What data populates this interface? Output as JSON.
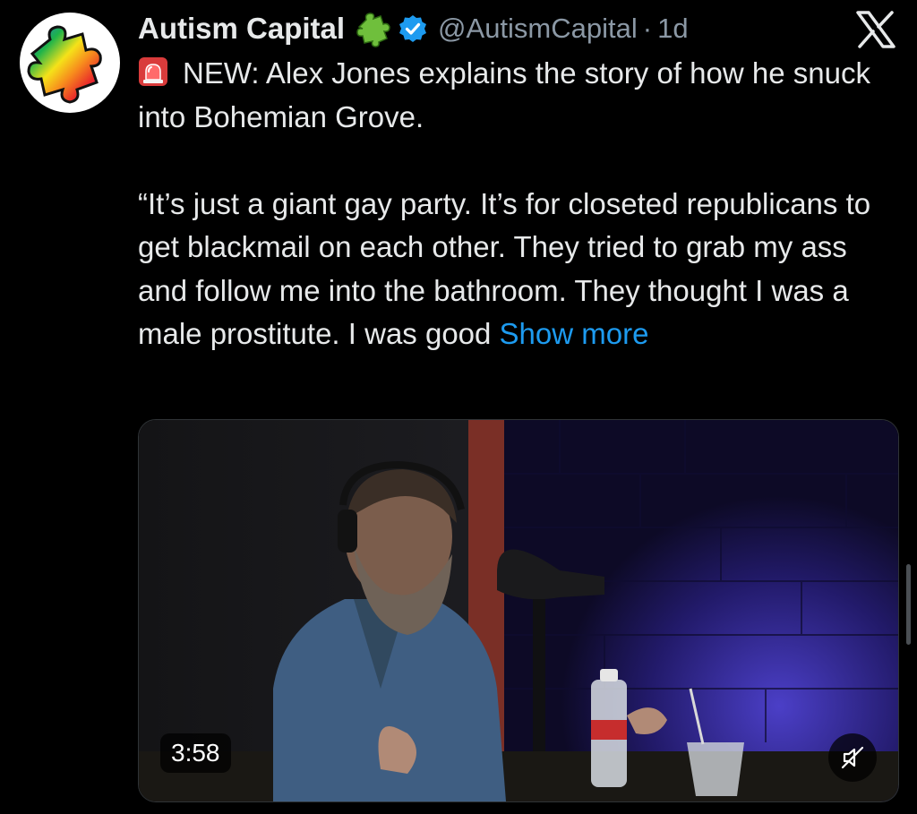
{
  "tweet": {
    "display_name": "Autism Capital",
    "handle": "@AutismCapital",
    "separator": "·",
    "time": "1d",
    "lines": [
      "NEW: Alex Jones explains the story of how he snuck into Bohemian Grove.",
      "“It’s just a giant gay party. It’s for closeted republicans to get blackmail on each other. They tried to grab my ass and follow me into the bathroom. They thought I was a male prostitute. I was good"
    ],
    "show_more": "Show more"
  },
  "video": {
    "duration": "3:58",
    "muted": true
  },
  "icons": {
    "avatar": "rainbow-puzzle-piece",
    "name_badge": "puzzle-piece-icon",
    "verified": "verified-check-icon",
    "alert": "police-siren-icon",
    "platform": "x-logo",
    "mute": "muted-speaker-icon"
  },
  "colors": {
    "background": "#000000",
    "text": "#e7e9ea",
    "secondary": "#8b98a5",
    "link": "#1d9bf0",
    "verified": "#1d9bf0"
  }
}
